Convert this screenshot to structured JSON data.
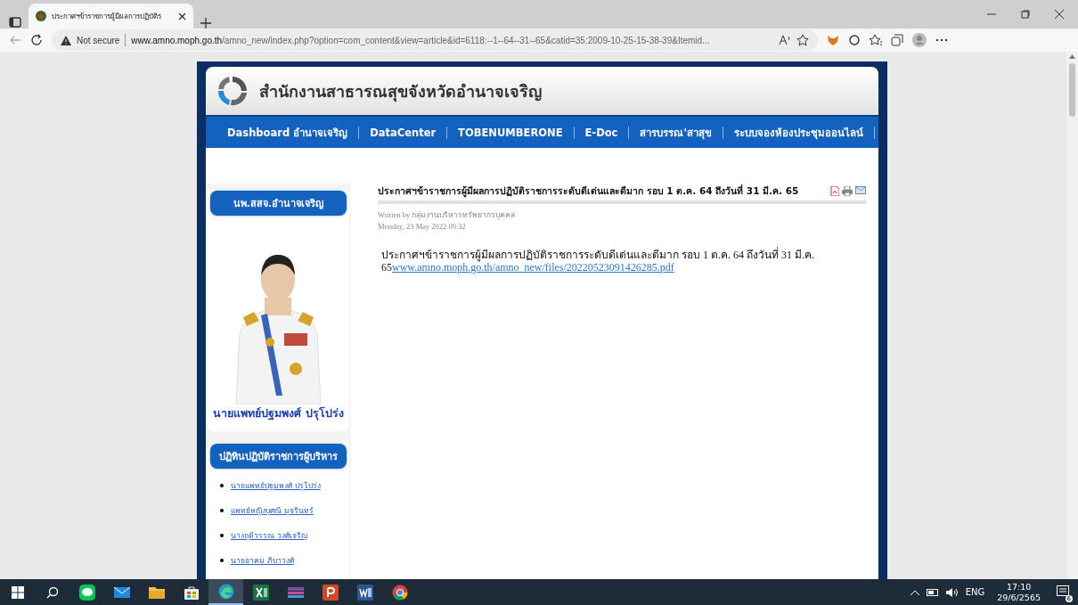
{
  "browser": {
    "tab": {
      "title": "ประกาศฯข้าราชการผู้มีผลการปฏิบัติร",
      "selected": true
    },
    "address": {
      "security": "Not secure",
      "url_host": "www.amno.moph.go.th",
      "url_path": "/amno_new/index.php?option=com_content&view=article&id=6118:--1--64--31--65&catid=35:2009-10-25-15-38-39&Itemid..."
    }
  },
  "site": {
    "title": "สำนักงานสาธารณสุขจังหวัดอำนาจเจริญ",
    "nav": [
      {
        "label": "Dashboard อำนาจเจริญ"
      },
      {
        "label": "DataCenter"
      },
      {
        "label": "TOBENUMBERONE"
      },
      {
        "label": "E-Doc"
      },
      {
        "label": "สารบรรณ'สาสุข"
      },
      {
        "label": "ระบบจองห้องประชุมออนไลน์"
      }
    ],
    "sidebar": {
      "director_heading": "นพ.สสจ.อำนาจเจริญ",
      "director_name": "นายแพทย์ปฐมพงศ์ ปรุโปร่ง",
      "calendar_heading": "ปฏิทินปฏิบัติราชการผู้บริหาร",
      "calendar_links": [
        "นายแพทย์ปฐมพงศ์ ปรุโปร่ง",
        "แพทย์หญิงบุศณี มุจรินทร์",
        "นางฤดีวรรณ  วงศ์เจริญ",
        "นายอาคม ภิบาวงศ์"
      ]
    },
    "article": {
      "title": "ประกาศฯข้าราชการผู้มีผลการปฏิบัติราชการระดับดีเด่นและดีมาก รอบ 1 ต.ค. 64 ถึงวันที่ 31 มี.ค. 65",
      "written_by": "Written by กลุ่มงานบริหารทรัพยากรบุคคล",
      "date": "Monday, 23 May 2022 09:32",
      "body": "ประกาศฯข้าราชการผู้มีผลการปฏิบัติราชการระดับดีเด่นและดีมาก รอบ 1 ต.ค. 64 ถึงวันที่ 31 มี.ค. 65",
      "link": "www.amno.moph.go.th/amno_new/files/20220523091426285.pdf"
    }
  },
  "taskbar": {
    "apps": [
      {
        "kind": "line",
        "selected": false
      },
      {
        "kind": "mail",
        "selected": false
      },
      {
        "kind": "files",
        "selected": false
      },
      {
        "kind": "store",
        "selected": false
      },
      {
        "kind": "edge",
        "selected": true
      },
      {
        "kind": "excel",
        "selected": false
      },
      {
        "kind": "app",
        "selected": false
      },
      {
        "kind": "powerpoint",
        "selected": false
      },
      {
        "kind": "word",
        "selected": false
      },
      {
        "kind": "chrome",
        "selected": false
      }
    ],
    "language": "ENG",
    "time": "17:10",
    "date": "29/6/2565",
    "notifications": "6"
  }
}
